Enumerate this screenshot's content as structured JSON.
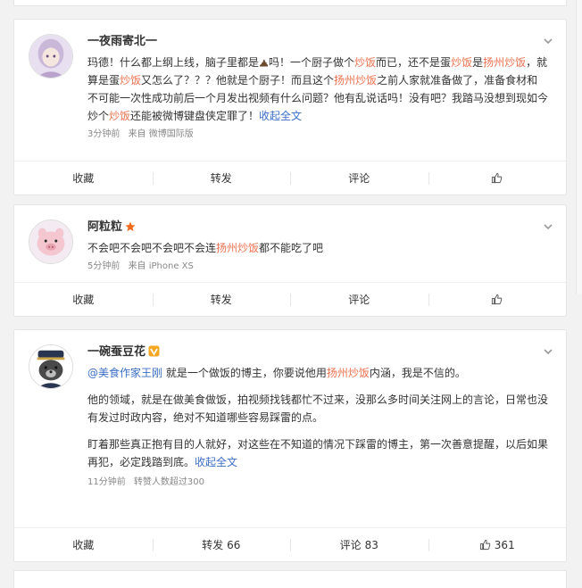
{
  "posts": [
    {
      "username": "一夜雨寄北一",
      "text_parts": [
        {
          "t": "玛德！什么都上纲上线，脑子里都是",
          "c": "n"
        },
        {
          "t": "poop-emoji",
          "c": "emo"
        },
        {
          "t": "吗！一个厨子做个",
          "c": "n"
        },
        {
          "t": "炒饭",
          "c": "hl"
        },
        {
          "t": "而已，还不是蛋",
          "c": "n"
        },
        {
          "t": "炒饭",
          "c": "hl"
        },
        {
          "t": "是",
          "c": "n"
        },
        {
          "t": "扬州炒饭",
          "c": "hl"
        },
        {
          "t": "，就算是蛋",
          "c": "n"
        },
        {
          "t": "炒饭",
          "c": "hl"
        },
        {
          "t": "又怎么了？？？他就是个厨子！而且这个",
          "c": "n"
        },
        {
          "t": "扬州炒饭",
          "c": "hl"
        },
        {
          "t": "之前人家就准备做了，准备食材和不可能一次性成功前后一个月发出视频有什么问题？他有乱说话吗！没有吧？我踏马没想到现如今炒个",
          "c": "n"
        },
        {
          "t": "炒饭",
          "c": "hl"
        },
        {
          "t": "还能被微博键盘侠定罪了！",
          "c": "n"
        },
        {
          "t": "收起全文",
          "c": "link"
        }
      ],
      "time": "3分钟前",
      "source": "来自 微博国际版",
      "actions": {
        "fav": "收藏",
        "repost": "转发",
        "comment": "评论",
        "like": ""
      }
    },
    {
      "username": "阿粒粒",
      "text_parts": [
        {
          "t": "不会吧不会吧不会吧不会连",
          "c": "n"
        },
        {
          "t": "扬州炒饭",
          "c": "hl"
        },
        {
          "t": "都不能吃了吧",
          "c": "n"
        }
      ],
      "time": "5分钟前",
      "source": "来自 iPhone XS",
      "actions": {
        "fav": "收藏",
        "repost": "转发",
        "comment": "评论",
        "like": ""
      }
    },
    {
      "username": "一碗蚕豆花",
      "paragraphs": [
        [
          {
            "t": "@美食作家王刚",
            "c": "link"
          },
          {
            "t": " 就是一个做饭的博主，你要说他用",
            "c": "n"
          },
          {
            "t": "扬州炒饭",
            "c": "hl"
          },
          {
            "t": "内涵，我是不信的。",
            "c": "n"
          }
        ],
        [
          {
            "t": "他的领域，就是在做美食做饭，拍视频找钱都忙不过来，没那么多时间关注网上的言论，日常也没有发过时政内容，绝对不知道哪些容易踩雷的点。",
            "c": "n"
          }
        ],
        [
          {
            "t": "盯着那些真正抱有目的人就好，对这些在不知道的情况下踩雷的博主，第一次善意提醒，以后如果再犯，必定践踏到底。",
            "c": "n"
          },
          {
            "t": "收起全文",
            "c": "link"
          }
        ]
      ],
      "time": "11分钟前",
      "source": "转赞人数超过300",
      "actions": {
        "fav": "收藏",
        "repost": "转发",
        "repost_count": "66",
        "comment": "评论",
        "comment_count": "83",
        "like": "",
        "like_count": "361"
      }
    }
  ],
  "colors": {
    "highlight": "#eb7350",
    "link": "#3c6ec6",
    "star": "#f26a1b",
    "vbadge": "#f5a623"
  }
}
